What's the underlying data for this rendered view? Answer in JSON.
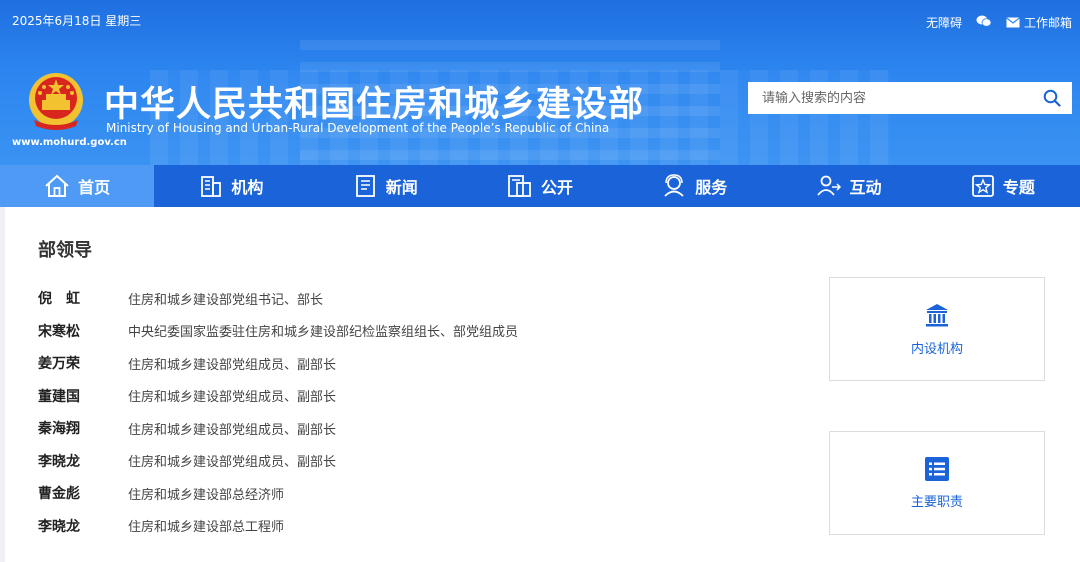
{
  "header": {
    "date": "2025年6月18日 星期三",
    "accessibility": "无障碍",
    "mail": "工作邮箱",
    "title": "中华人民共和国住房和城乡建设部",
    "subtitle": "Ministry of Housing and Urban-Rural Development of the People’s Republic of China",
    "url": "www.mohurd.gov.cn"
  },
  "search": {
    "placeholder": "请输入搜索的内容"
  },
  "nav": [
    {
      "label": "首页",
      "icon": "home-icon"
    },
    {
      "label": "机构",
      "icon": "building-icon"
    },
    {
      "label": "新闻",
      "icon": "news-icon"
    },
    {
      "label": "公开",
      "icon": "disclosure-icon"
    },
    {
      "label": "服务",
      "icon": "service-icon"
    },
    {
      "label": "互动",
      "icon": "interaction-icon"
    },
    {
      "label": "专题",
      "icon": "topic-icon"
    }
  ],
  "section": {
    "title": "部领导"
  },
  "leaders": [
    {
      "name": "倪　虹",
      "role": "住房和城乡建设部党组书记、部长"
    },
    {
      "name": "宋寒松",
      "role": "中央纪委国家监委驻住房和城乡建设部纪检监察组组长、部党组成员"
    },
    {
      "name": "姜万荣",
      "role": "住房和城乡建设部党组成员、副部长"
    },
    {
      "name": "董建国",
      "role": "住房和城乡建设部党组成员、副部长"
    },
    {
      "name": "秦海翔",
      "role": "住房和城乡建设部党组成员、副部长"
    },
    {
      "name": "李晓龙",
      "role": "住房和城乡建设部党组成员、副部长"
    },
    {
      "name": "曹金彪",
      "role": "住房和城乡建设部总经济师"
    },
    {
      "name": "李晓龙",
      "role": "住房和城乡建设部总工程师"
    }
  ],
  "cards": [
    {
      "label": "内设机构",
      "icon": "institution-icon"
    },
    {
      "label": "主要职责",
      "icon": "list-icon"
    }
  ],
  "colors": {
    "brand_blue": "#1a63d8",
    "nav_active": "#4e9af5"
  }
}
